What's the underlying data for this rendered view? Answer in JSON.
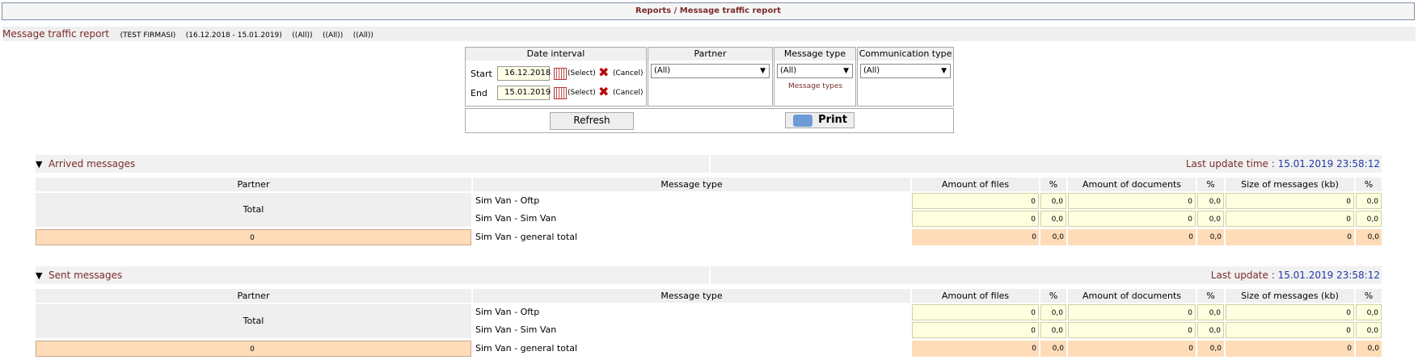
{
  "breadcrumb": "Reports / Message traffic report",
  "report": {
    "title": "Message traffic report",
    "params": [
      "(TEST FIRMASI)",
      "(16.12.2018 - 15.01.2019)",
      "((All))",
      "((All))",
      "((All))"
    ]
  },
  "filters": {
    "date_interval_label": "Date interval",
    "start_label": "Start",
    "end_label": "End",
    "start_value": "16.12.2018",
    "end_value": "15.01.2019",
    "select_label": "(Select)",
    "cancel_label": "(Cancel)",
    "partner_label": "Partner",
    "partner_value": "(All)",
    "message_type_label": "Message type",
    "message_type_value": "(All)",
    "message_types_link": "Message types",
    "communication_type_label": "Communication type",
    "communication_type_value": "(All)",
    "refresh_label": "Refresh",
    "print_label": "Print"
  },
  "columns": {
    "partner": "Partner",
    "message_type": "Message type",
    "amount_of_files": "Amount of files",
    "pct": "%",
    "amount_of_documents": "Amount of documents",
    "size_of_messages": "Size of messages (kb)"
  },
  "arrived": {
    "title": "Arrived messages",
    "update_label": "Last update time :",
    "update_value": "15.01.2019 23:58:12",
    "total_label": "Total",
    "rows": [
      {
        "type": "Sim Van - Oftp",
        "files": "0",
        "files_pct": "0,0",
        "docs": "0",
        "docs_pct": "0,0",
        "size": "0",
        "size_pct": "0,0"
      },
      {
        "type": "Sim Van - Sim Van",
        "files": "0",
        "files_pct": "0,0",
        "docs": "0",
        "docs_pct": "0,0",
        "size": "0",
        "size_pct": "0,0"
      }
    ],
    "general": {
      "partner": "0",
      "type": "Sim Van - general total",
      "files": "0",
      "files_pct": "0,0",
      "docs": "0",
      "docs_pct": "0,0",
      "size": "0",
      "size_pct": "0,0"
    }
  },
  "sent": {
    "title": "Sent messages",
    "update_label": "Last update :",
    "update_value": "15.01.2019 23:58:12",
    "total_label": "Total",
    "rows": [
      {
        "type": "Sim Van - Oftp",
        "files": "0",
        "files_pct": "0,0",
        "docs": "0",
        "docs_pct": "0,0",
        "size": "0",
        "size_pct": "0,0"
      },
      {
        "type": "Sim Van - Sim Van",
        "files": "0",
        "files_pct": "0,0",
        "docs": "0",
        "docs_pct": "0,0",
        "size": "0",
        "size_pct": "0,0"
      }
    ],
    "general": {
      "partner": "0",
      "type": "Sim Van - general total",
      "files": "0",
      "files_pct": "0,0",
      "docs": "0",
      "docs_pct": "0,0",
      "size": "0",
      "size_pct": "0,0"
    }
  }
}
